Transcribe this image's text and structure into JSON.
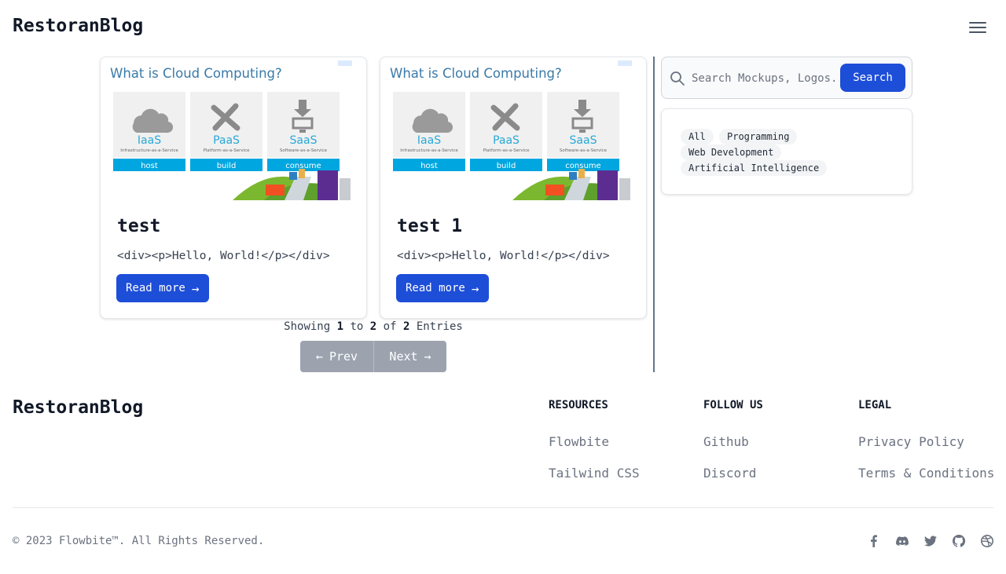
{
  "header": {
    "brand": "RestoranBlog",
    "menu_icon": "hamburger-icon"
  },
  "thumbnail": {
    "heading": "What is Cloud Computing?",
    "tiles": [
      {
        "name": "IaaS",
        "caption": "Infrastructure-as-a-Service",
        "bar": "host"
      },
      {
        "name": "PaaS",
        "caption": "Platform-as-a-Service",
        "bar": "build"
      },
      {
        "name": "SaaS",
        "caption": "Software-as-a-Service",
        "bar": "consume"
      }
    ]
  },
  "posts": [
    {
      "title": "test",
      "excerpt": "<div><p>Hello, World!</p></div>",
      "button": "Read more"
    },
    {
      "title": "test 1",
      "excerpt": "<div><p>Hello, World!</p></div>",
      "button": "Read more"
    }
  ],
  "pagination": {
    "showing": "Showing",
    "from": "1",
    "to_word": "to",
    "to": "2",
    "of_word": "of",
    "total": "2",
    "entries": "Entries",
    "prev": "Prev",
    "next": "Next"
  },
  "sidebar": {
    "search": {
      "placeholder": "Search Mockups, Logos...",
      "button": "Search"
    },
    "tags": [
      "All",
      "Programming",
      "Web Development",
      "Artificial Intelligence"
    ]
  },
  "footer": {
    "brand": "RestoranBlog",
    "columns": [
      {
        "heading": "RESOURCES",
        "links": [
          "Flowbite",
          "Tailwind CSS"
        ]
      },
      {
        "heading": "FOLLOW US",
        "links": [
          "Github",
          "Discord"
        ]
      },
      {
        "heading": "LEGAL",
        "links": [
          "Privacy Policy",
          "Terms & Conditions"
        ]
      }
    ],
    "copyright": "© 2023 Flowbite™. All Rights Reserved.",
    "social": [
      "facebook-icon",
      "discord-icon",
      "twitter-icon",
      "github-icon",
      "dribbble-icon"
    ]
  },
  "colors": {
    "primary": "#1d4ed8",
    "pager_bg": "#9ca3af",
    "divider": "#64748b",
    "tile_bar": "#00a6e0",
    "tile_text": "#28a8d8"
  }
}
